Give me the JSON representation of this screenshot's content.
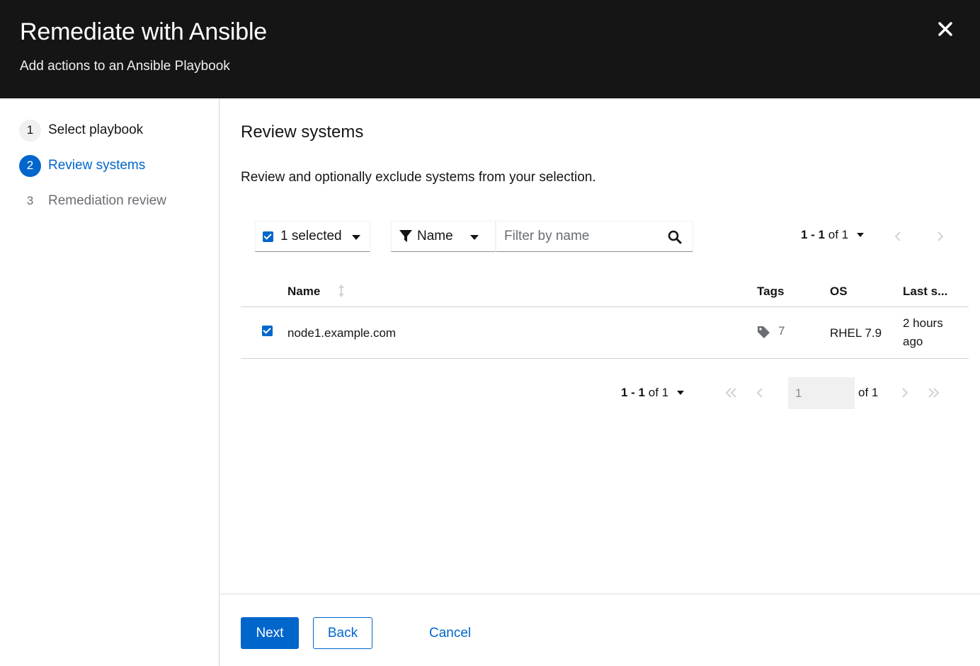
{
  "header": {
    "title": "Remediate with Ansible",
    "subtitle": "Add actions to an Ansible Playbook"
  },
  "wizard": {
    "steps": [
      {
        "number": "1",
        "label": "Select playbook",
        "state": "done"
      },
      {
        "number": "2",
        "label": "Review systems",
        "state": "current"
      },
      {
        "number": "3",
        "label": "Remediation review",
        "state": "disabled"
      }
    ]
  },
  "main": {
    "title": "Review systems",
    "description": "Review and optionally exclude systems from your selection."
  },
  "toolbar": {
    "bulk_select_label": "1 selected",
    "filter_attribute": "Name",
    "search_placeholder": "Filter by name",
    "pagination_range": "1 - 1",
    "pagination_total": "of 1"
  },
  "table": {
    "columns": {
      "name": "Name",
      "tags": "Tags",
      "os": "OS",
      "last_seen": "Last s..."
    },
    "rows": [
      {
        "name": "node1.example.com",
        "tags_count": "7",
        "os": "RHEL 7.9",
        "last_seen_line1": "2 hours",
        "last_seen_line2": "ago",
        "selected": true
      }
    ]
  },
  "pagination_bottom": {
    "range": "1 - 1",
    "total": "of 1",
    "current_page": "1",
    "of_pages": "of 1"
  },
  "footer": {
    "next_label": "Next",
    "back_label": "Back",
    "cancel_label": "Cancel"
  },
  "colors": {
    "header_bg": "#151515",
    "primary": "#0066cc",
    "muted": "#6a6e73",
    "border": "#d2d2d2"
  }
}
